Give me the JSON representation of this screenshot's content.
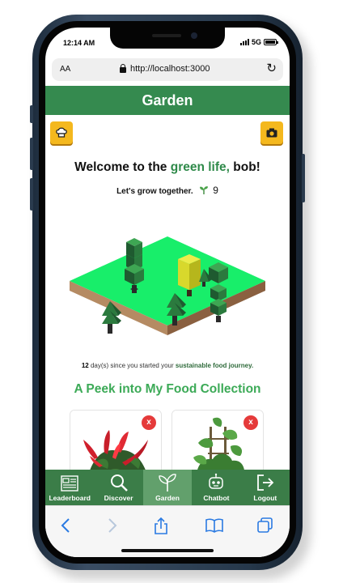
{
  "status": {
    "time": "12:14 AM",
    "network": "5G"
  },
  "browser": {
    "text_size": "AA",
    "url": "http://localhost:3000"
  },
  "header": {
    "title": "Garden"
  },
  "welcome": {
    "prefix": "Welcome to the ",
    "highlight": "green life,",
    "suffix": " bob!"
  },
  "tagline": {
    "text": "Let's grow together.",
    "count": "9"
  },
  "days": {
    "count": "12",
    "middle": " day(s) since you started your ",
    "highlight": "sustainable food journey."
  },
  "collection": {
    "title": "A Peek into My Food Collection",
    "remove_label": "x"
  },
  "nav": [
    {
      "label": "Leaderboard",
      "icon": "leaderboard-icon"
    },
    {
      "label": "Discover",
      "icon": "search-icon"
    },
    {
      "label": "Garden",
      "icon": "plant-icon"
    },
    {
      "label": "Chatbot",
      "icon": "robot-icon"
    },
    {
      "label": "Logout",
      "icon": "logout-icon"
    }
  ],
  "colors": {
    "brand_green": "#358a4f",
    "accent_yellow": "#f4b81e",
    "active_tab": "#62a06c",
    "remove_red": "#e53a3a"
  }
}
